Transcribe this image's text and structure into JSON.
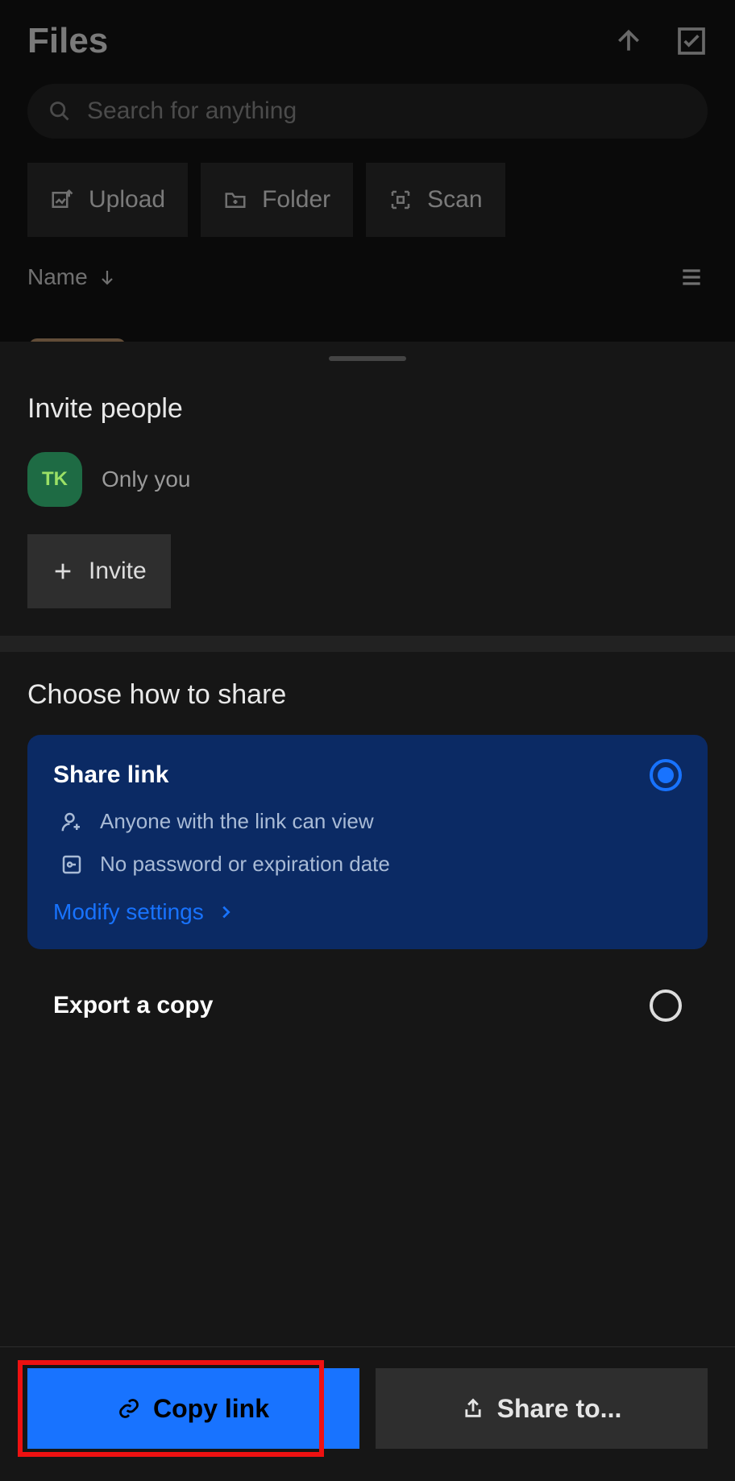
{
  "header": {
    "title": "Files"
  },
  "search": {
    "placeholder": "Search for anything"
  },
  "actions": {
    "upload": "Upload",
    "folder": "Folder",
    "scan": "Scan"
  },
  "list": {
    "sort_label": "Name"
  },
  "sheet": {
    "invite_title": "Invite people",
    "avatar_initials": "TK",
    "only_you": "Only you",
    "invite_button": "Invite",
    "share_title": "Choose how to share",
    "share_link": {
      "label": "Share link",
      "line1": "Anyone with the link can view",
      "line2": "No password or expiration date",
      "modify": "Modify settings"
    },
    "export": {
      "label": "Export a copy"
    }
  },
  "bottom": {
    "copy": "Copy link",
    "share_to": "Share to..."
  }
}
